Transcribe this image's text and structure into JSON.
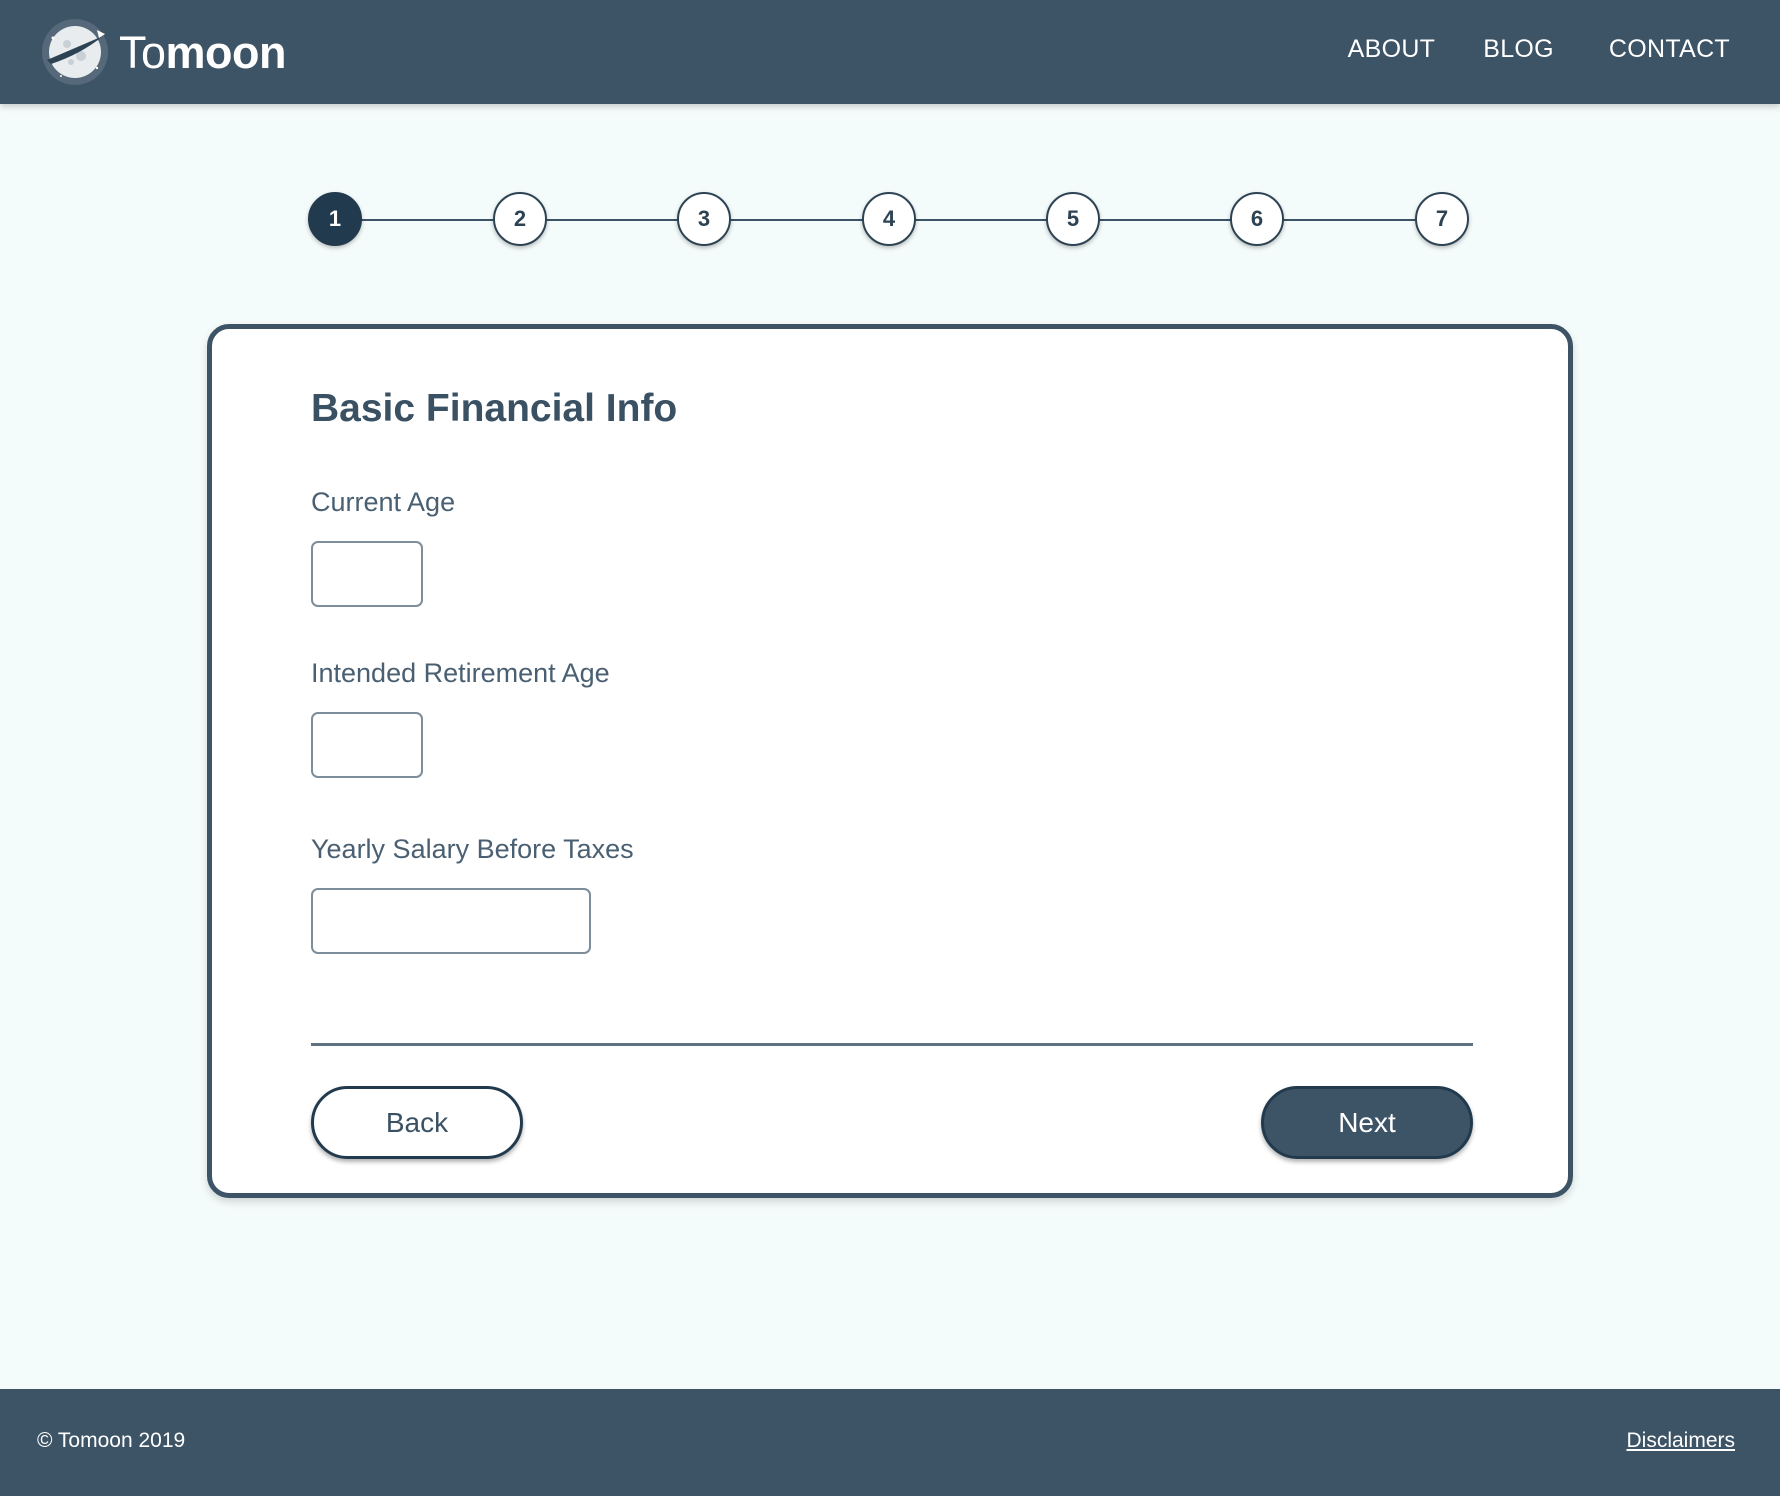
{
  "header": {
    "logo_light": "To",
    "logo_bold": "moon",
    "nav": [
      {
        "label": "ABOUT"
      },
      {
        "label": "BLOG"
      },
      {
        "label": "CONTACT"
      }
    ]
  },
  "stepper": {
    "current_step": 1,
    "steps": [
      "1",
      "2",
      "3",
      "4",
      "5",
      "6",
      "7"
    ]
  },
  "form": {
    "title": "Basic Financial Info",
    "fields": [
      {
        "label": "Current Age",
        "value": ""
      },
      {
        "label": "Intended Retirement Age",
        "value": ""
      },
      {
        "label": "Yearly Salary Before Taxes",
        "value": ""
      }
    ],
    "back_label": "Back",
    "next_label": "Next"
  },
  "footer": {
    "copyright": "© Tomoon 2019",
    "disclaimers_label": "Disclaimers"
  },
  "colors": {
    "header_bg": "#3d5366",
    "page_bg": "#f4fbfb",
    "accent_dark": "#223a4d",
    "text": "#3a5164"
  }
}
